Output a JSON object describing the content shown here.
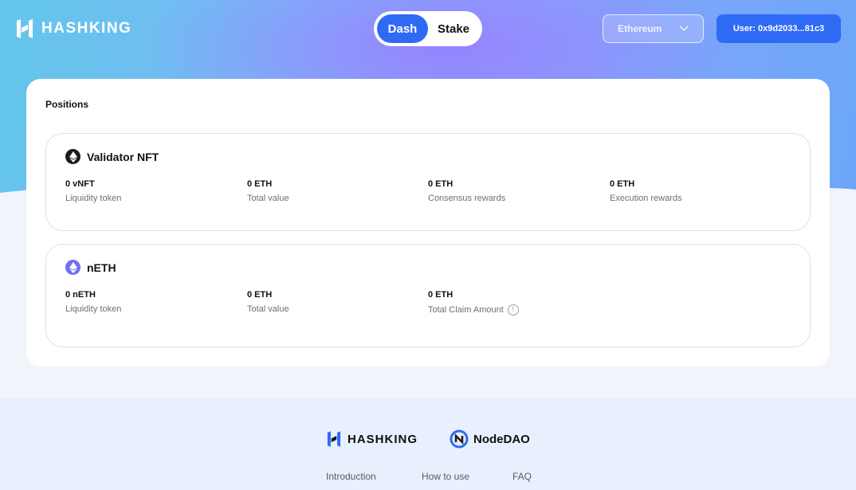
{
  "header": {
    "brand": "HASHKING",
    "tabs": [
      {
        "label": "Dash",
        "active": true
      },
      {
        "label": "Stake",
        "active": false
      }
    ],
    "network": {
      "selected": "Ethereum"
    },
    "user_label": "User: 0x9d2033...81c3"
  },
  "positions": {
    "title": "Positions",
    "cards": [
      {
        "name": "Validator NFT",
        "icon": "ethereum-icon",
        "stats": [
          {
            "value": "0 vNFT",
            "label": "Liquidity token"
          },
          {
            "value": "0 ETH",
            "label": "Total value"
          },
          {
            "value": "0 ETH",
            "label": "Consensus rewards"
          },
          {
            "value": "0 ETH",
            "label": "Execution rewards"
          }
        ]
      },
      {
        "name": "nETH",
        "icon": "neth-icon",
        "stats": [
          {
            "value": "0 nETH",
            "label": "Liquidity token"
          },
          {
            "value": "0 ETH",
            "label": "Total value"
          },
          {
            "value": "0 ETH",
            "label": "Total Claim Amount"
          }
        ]
      }
    ]
  },
  "footer": {
    "logos": [
      "HASHKING",
      "NodeDAO"
    ],
    "links": [
      "Introduction",
      "How to use",
      "FAQ"
    ]
  },
  "colors": {
    "accent": "#2f6af5",
    "card_border": "#dde2ea",
    "footer_bg": "#e8f0fd"
  }
}
